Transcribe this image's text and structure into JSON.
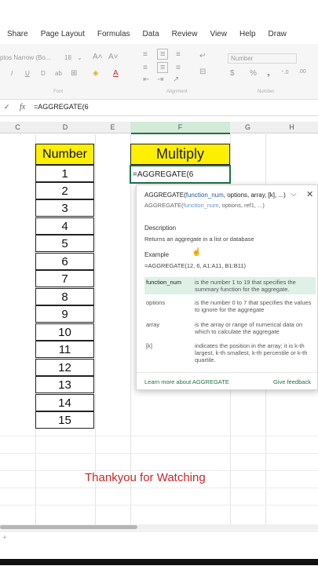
{
  "tabs": [
    "Share",
    "Page Layout",
    "Formulas",
    "Data",
    "Review",
    "View",
    "Help",
    "Draw"
  ],
  "ribbon": {
    "font_name": "ptos Narrow (Bo...",
    "font_size": "18",
    "number_format": "Number",
    "font_group": "Font",
    "alignment_group": "Alignment",
    "number_group": "Number"
  },
  "formula_bar": {
    "value": "=AGGREGATE(6"
  },
  "columns": [
    "C",
    "D",
    "E",
    "F",
    "G",
    "H"
  ],
  "table": {
    "header": "Number",
    "values": [
      "1",
      "2",
      "3",
      "4",
      "5",
      "6",
      "7",
      "8",
      "9",
      "10",
      "11",
      "12",
      "13",
      "14",
      "15"
    ]
  },
  "multiply_header": "Multiply",
  "active_cell_text": "=AGGREGATE(6",
  "tooltip": {
    "signature_fn": "AGGREGATE(",
    "signature_bold": "function_num",
    "signature_rest": ", options, array, [k], ...)",
    "signature2_fn": "AGGREGATE(",
    "signature2_bold": "function_num",
    "signature2_rest": ", options, ref1, ...)",
    "description_title": "Description",
    "description": "Returns an aggregate in a list or database",
    "example_title": "Example",
    "example": "=AGGREGATE(12, 6, A1:A11, B1:B11)",
    "args": [
      {
        "name": "function_num",
        "desc": "is the number 1 to 19 that specifies the summary function for the aggregate."
      },
      {
        "name": "options",
        "desc": "is the number 0 to 7 that specifies the values to ignore for the aggregate"
      },
      {
        "name": "array",
        "desc": "is the array or range of numerical data on which to calculate the aggregate"
      },
      {
        "name": "[k]",
        "desc": "indicates the position in the array; it is k-th largest, k-th smallest, k-th percentile or k-th quartile."
      }
    ],
    "learn_more": "Learn more about AGGREGATE",
    "feedback": "Give feedback"
  },
  "footer_text": "Thankyou for Watching",
  "colors": {
    "accent_green": "#1e7145",
    "highlight_yellow": "#ffef00",
    "footer_red": "#c62828",
    "arg_highlight": "#dff0e6"
  }
}
